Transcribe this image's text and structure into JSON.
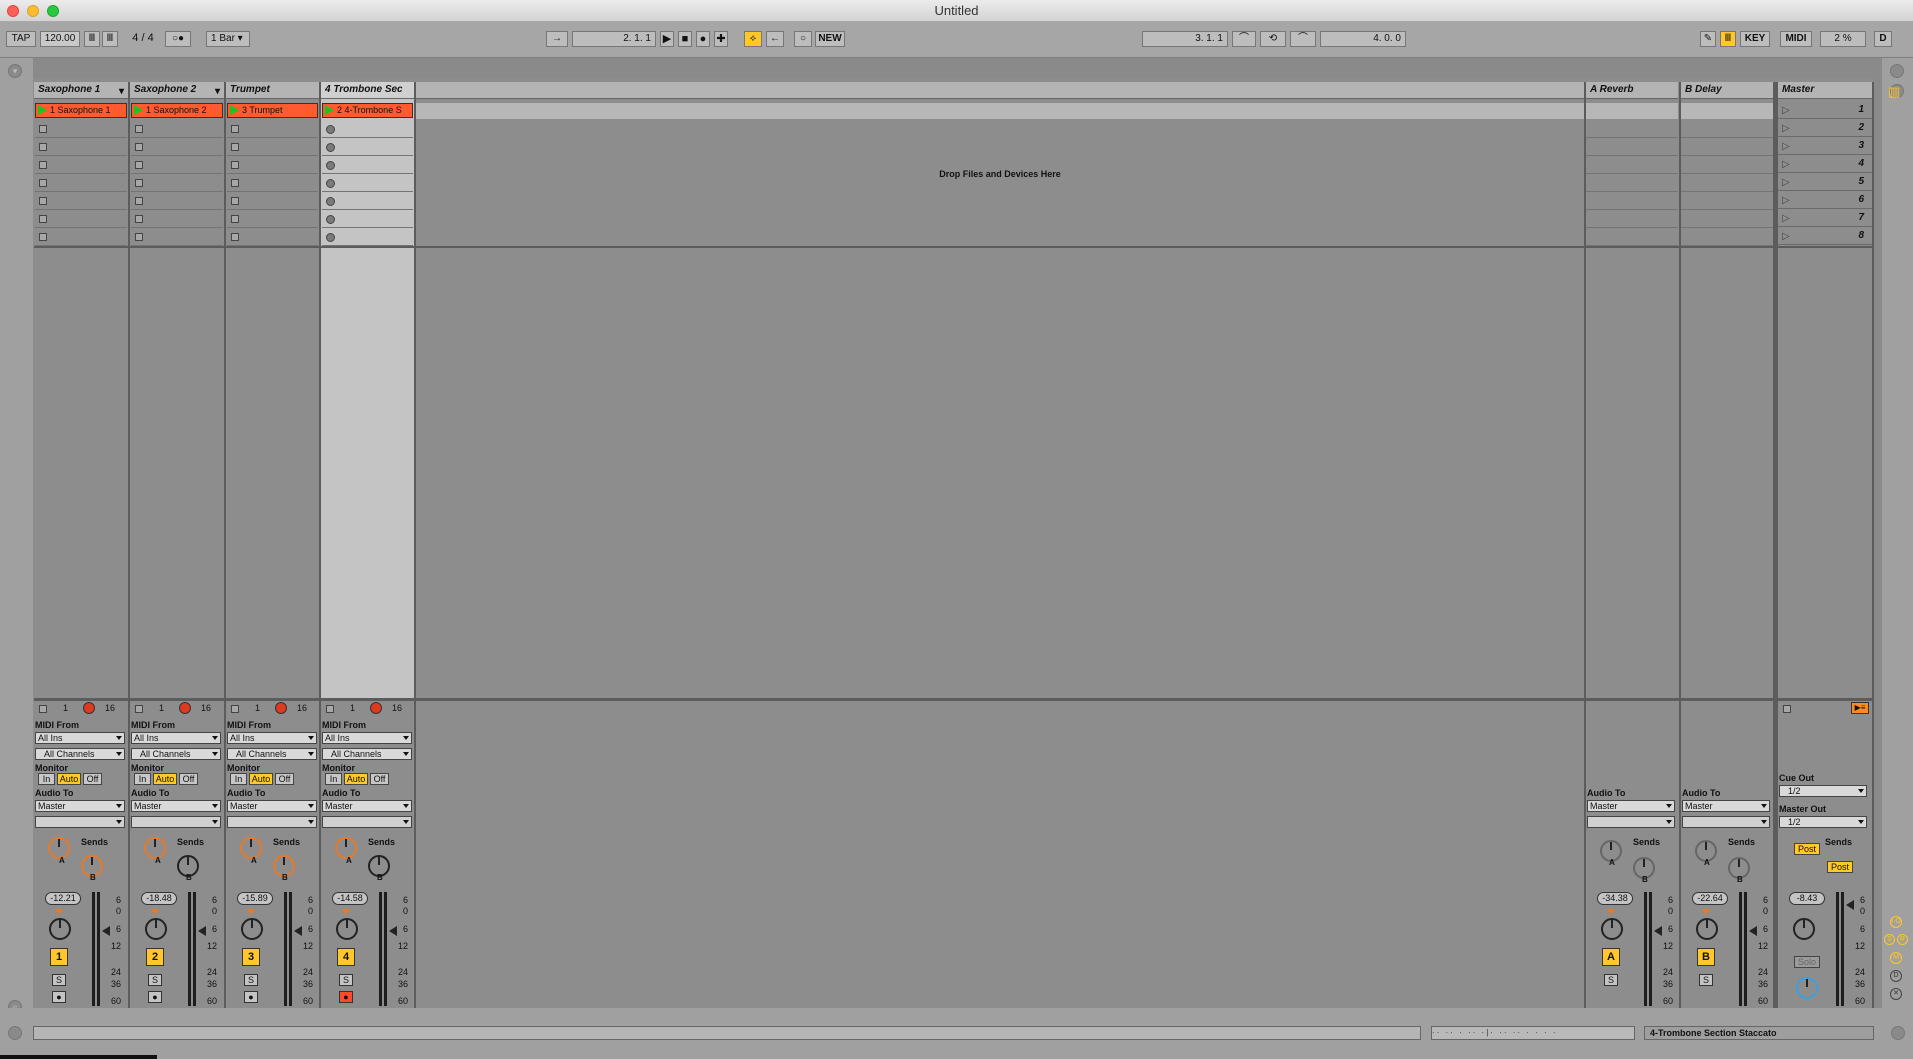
{
  "window": {
    "title": "Untitled"
  },
  "toolbar": {
    "tap": "TAP",
    "tempo": "120.00",
    "signature": "4 / 4",
    "quantize": "1 Bar",
    "arrangement_pos": "2.   1.   1",
    "new": "NEW",
    "loop_start": "3.   1.   1",
    "loop_length": "4.   0.   0",
    "key": "KEY",
    "midi": "MIDI",
    "cpu": "2 %",
    "d": "D"
  },
  "tracks": [
    {
      "name": "Saxophone 1",
      "clip": "1 Saxophone 1",
      "num": "1",
      "volume": "-12.21"
    },
    {
      "name": "Saxophone 2",
      "clip": "1 Saxophone 2",
      "num": "2",
      "volume": "-18.48"
    },
    {
      "name": "Trumpet",
      "clip": "3 Trumpet",
      "num": "3",
      "volume": "-15.89"
    },
    {
      "name": "4 Trombone Sec",
      "clip": "2 4-Trombone S",
      "num": "4",
      "volume": "-14.58"
    }
  ],
  "returns": [
    {
      "name": "A Reverb",
      "num": "A",
      "volume": "-34.38"
    },
    {
      "name": "B Delay",
      "num": "B",
      "volume": "-22.64"
    }
  ],
  "master": {
    "name": "Master",
    "volume": "-8.43",
    "scenes": [
      "1",
      "2",
      "3",
      "4",
      "5",
      "6",
      "7",
      "8"
    ],
    "cue_out_label": "Cue Out",
    "cue_out": "1/2",
    "master_out_label": "Master Out",
    "master_out": "1/2",
    "post": "Post",
    "solo": "Solo"
  },
  "drop_hint": "Drop Files and Devices Here",
  "io": {
    "midi_from": "MIDI From",
    "all_ins": "All Ins",
    "all_channels": "All Channels",
    "monitor": "Monitor",
    "in": "In",
    "auto": "Auto",
    "off": "Off",
    "audio_to": "Audio To",
    "master": "Master",
    "sends": "Sends",
    "knob_a": "A",
    "knob_b": "B",
    "solo_btn": "S",
    "bar_num": "1",
    "bar_max": "16"
  },
  "meter_scale": [
    "6",
    "0",
    "6",
    "12",
    "24",
    "36",
    "60"
  ],
  "status": {
    "instrument": "4-Trombone Section Staccato"
  }
}
